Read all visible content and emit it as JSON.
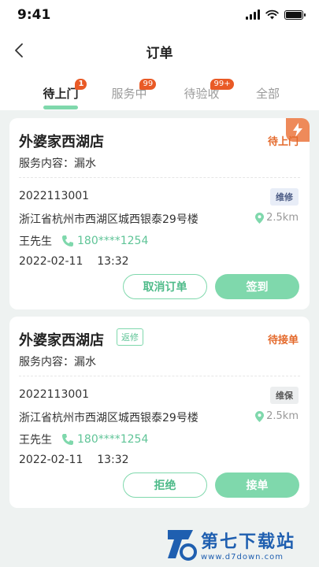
{
  "status_bar": {
    "time": "9:41"
  },
  "nav": {
    "title": "订单"
  },
  "tabs": [
    {
      "label": "待上门",
      "badge": "1"
    },
    {
      "label": "服务中",
      "badge": "99"
    },
    {
      "label": "待验收",
      "badge": "99+"
    },
    {
      "label": "全部"
    }
  ],
  "orders": [
    {
      "shop": "外婆家西湖店",
      "status": "待上门",
      "service": "服务内容：漏水",
      "order_no": "2022113001",
      "type": "维修",
      "address": "浙江省杭州市西湖区城西银泰29号楼",
      "distance": "2.5km",
      "contact_name": "王先生",
      "phone": "180****1254",
      "date": "2022-02-11",
      "time": "13:32",
      "btn_secondary": "取消订单",
      "btn_primary": "签到"
    },
    {
      "shop": "外婆家西湖店",
      "tag": "返修",
      "status": "待接单",
      "service": "服务内容：漏水",
      "order_no": "2022113001",
      "type": "维保",
      "address": "浙江省杭州市西湖区城西银泰29号楼",
      "distance": "2.5km",
      "contact_name": "王先生",
      "phone": "180****1254",
      "date": "2022-02-11",
      "time": "13:32",
      "btn_secondary": "拒绝",
      "btn_primary": "接单"
    }
  ],
  "watermark": {
    "name": "第七下载站",
    "url": "www.d7down.com"
  },
  "colors": {
    "accent": "#7fd8ac",
    "status_orange": "#e46a2c",
    "badge": "#e95a26"
  }
}
